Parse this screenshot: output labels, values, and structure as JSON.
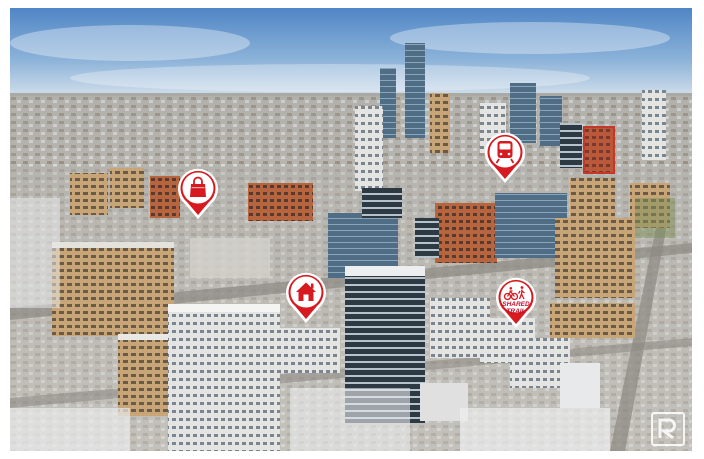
{
  "photo": {
    "subject": "aerial-downtown-winter",
    "colors": {
      "sky": "#5d8fc8",
      "sky_light": "#d9e4ee",
      "snow": "#e9ecef",
      "pin_red": "#d71920",
      "pin_white": "#ffffff"
    }
  },
  "pins": [
    {
      "icon": "shopping-bag-icon",
      "label": ""
    },
    {
      "icon": "train-icon",
      "label": ""
    },
    {
      "icon": "home-icon",
      "label": ""
    },
    {
      "icon": "bicycle-pedestrian-icon",
      "label": "SHARED\nTRAIL"
    }
  ],
  "watermark": {
    "icon": "realtor-logo-icon"
  }
}
